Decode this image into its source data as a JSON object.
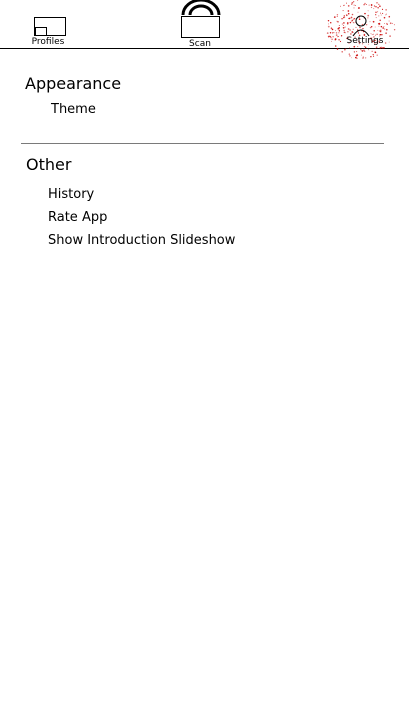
{
  "tabs": {
    "profiles": {
      "label": "Profiles",
      "icon": "profiles-icon"
    },
    "scan": {
      "label": "Scan",
      "icon": "scan-icon"
    },
    "settings": {
      "label": "Settings",
      "icon": "settings-icon",
      "active": true
    }
  },
  "sections": {
    "appearance": {
      "title": "Appearance",
      "items": [
        "Theme"
      ]
    },
    "other": {
      "title": "Other",
      "items": [
        "History",
        "Rate App",
        "Show Introduction Slideshow"
      ]
    }
  },
  "colors": {
    "highlight": "#cc0000",
    "text": "#000000",
    "divider": "#7a7a7a"
  }
}
